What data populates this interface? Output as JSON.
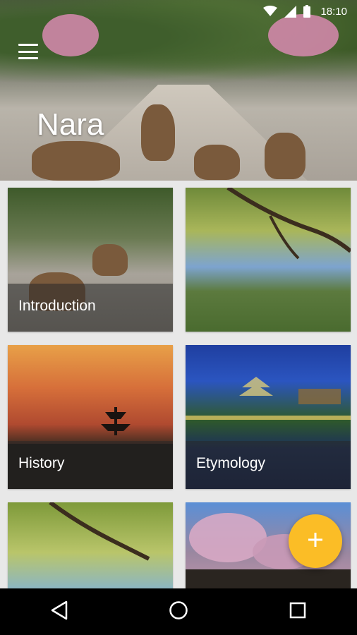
{
  "status_bar": {
    "time": "18:10",
    "icons": [
      "wifi-icon",
      "signal-icon",
      "battery-icon"
    ]
  },
  "header": {
    "title": "Nara",
    "menu_icon": "menu-icon"
  },
  "tiles": [
    {
      "label": "Introduction",
      "scene": "deer-on-path"
    },
    {
      "label": "",
      "scene": "tree-branches-and-lawn"
    },
    {
      "label": "History",
      "scene": "pagoda-sunset"
    },
    {
      "label": "Etymology",
      "scene": "temple-at-night"
    },
    {
      "label": "",
      "scene": "maple-branches-sky"
    },
    {
      "label": "",
      "scene": "cherry-blossom-crowd"
    }
  ],
  "fab": {
    "icon": "plus-icon",
    "color": "#fbbd26"
  },
  "nav_bar": {
    "buttons": [
      "back-icon",
      "home-icon",
      "recents-icon"
    ]
  },
  "colors": {
    "accent": "#fbbd26",
    "background": "#e8e8e8",
    "nav_bar": "#000000"
  }
}
